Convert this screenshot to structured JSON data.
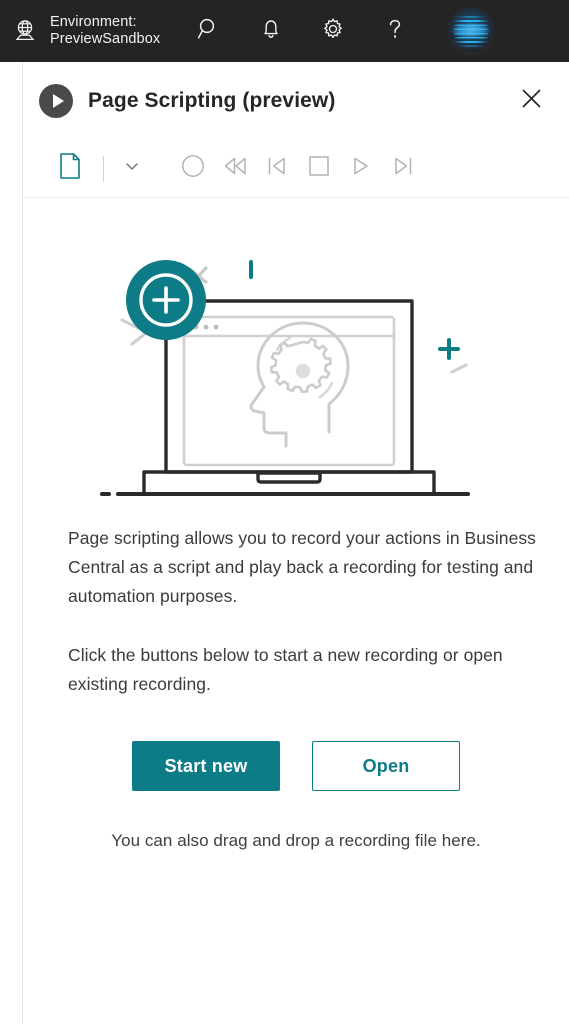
{
  "app_bar": {
    "environment_icon": "globe-environment-icon",
    "environment_label_line1": "Environment:",
    "environment_label_line2": "PreviewSandbox",
    "environment_label": "Environment: PreviewSandbox",
    "actions": [
      {
        "name": "search-icon",
        "label": "Search"
      },
      {
        "name": "notifications-bell-icon",
        "label": "Notifications"
      },
      {
        "name": "settings-gear-icon",
        "label": "Settings"
      },
      {
        "name": "help-question-icon",
        "label": "Help"
      }
    ],
    "avatar_label": "Account",
    "background_color": "#242424"
  },
  "panel": {
    "title": "Page Scripting (preview)",
    "play_badge_icon": "play-circle-icon",
    "close_icon": "close-icon",
    "close_label": "Close"
  },
  "toolbar": {
    "items": [
      {
        "name": "new-file-icon",
        "label": "New"
      },
      {
        "name": "chevron-down-icon",
        "label": "More options"
      },
      {
        "name": "record-circle-icon",
        "label": "Record"
      },
      {
        "name": "rewind-icon",
        "label": "Rewind"
      },
      {
        "name": "step-back-icon",
        "label": "Step back"
      },
      {
        "name": "stop-square-icon",
        "label": "Stop"
      },
      {
        "name": "play-triangle-icon",
        "label": "Play"
      },
      {
        "name": "step-forward-icon",
        "label": "Step forward"
      }
    ]
  },
  "illustration": {
    "name": "page-scripting-laptop-illustration",
    "badge_icon": "plus-circle-badge-icon",
    "screen_icon": "head-with-gear-icon",
    "accent_color": "#0e7c86"
  },
  "content": {
    "paragraph_1": "Page scripting allows you to record your actions in Business Central as a script and play back a recording for testing and automation purposes.",
    "paragraph_2": "Click the buttons below to start a new recording or open existing recording.",
    "drag_hint": "You can also drag and drop a recording file here."
  },
  "buttons": {
    "start_new": "Start new",
    "open": "Open"
  },
  "colors": {
    "accent_teal": "#0e7c86",
    "app_bar": "#242424",
    "text": "#3b3b3b"
  }
}
